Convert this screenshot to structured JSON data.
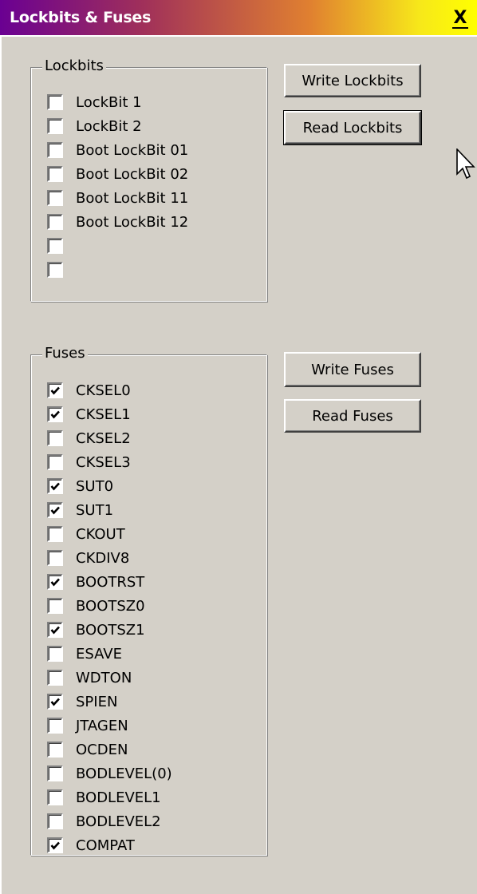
{
  "window": {
    "title": "Lockbits & Fuses",
    "close_label": "X"
  },
  "lockbits": {
    "legend": "Lockbits",
    "items": [
      {
        "label": "LockBit 1",
        "checked": false
      },
      {
        "label": "LockBit 2",
        "checked": false
      },
      {
        "label": "Boot LockBit 01",
        "checked": false
      },
      {
        "label": "Boot LockBit 02",
        "checked": false
      },
      {
        "label": "Boot LockBit 11",
        "checked": false
      },
      {
        "label": "Boot LockBit 12",
        "checked": false
      },
      {
        "label": "",
        "checked": false
      },
      {
        "label": "",
        "checked": false
      }
    ]
  },
  "lockbit_buttons": {
    "write_label": "Write Lockbits",
    "read_label": "Read Lockbits"
  },
  "fuses": {
    "legend": "Fuses",
    "items": [
      {
        "label": "CKSEL0",
        "checked": true
      },
      {
        "label": "CKSEL1",
        "checked": true
      },
      {
        "label": "CKSEL2",
        "checked": false
      },
      {
        "label": "CKSEL3",
        "checked": false
      },
      {
        "label": "SUT0",
        "checked": true
      },
      {
        "label": "SUT1",
        "checked": true
      },
      {
        "label": "CKOUT",
        "checked": false
      },
      {
        "label": "CKDIV8",
        "checked": false
      },
      {
        "label": "BOOTRST",
        "checked": true
      },
      {
        "label": "BOOTSZ0",
        "checked": false
      },
      {
        "label": "BOOTSZ1",
        "checked": true
      },
      {
        "label": "ESAVE",
        "checked": false
      },
      {
        "label": "WDTON",
        "checked": false
      },
      {
        "label": "SPIEN",
        "checked": true
      },
      {
        "label": "JTAGEN",
        "checked": false
      },
      {
        "label": "OCDEN",
        "checked": false
      },
      {
        "label": "BODLEVEL(0)",
        "checked": false
      },
      {
        "label": "BODLEVEL1",
        "checked": false
      },
      {
        "label": "BODLEVEL2",
        "checked": false
      },
      {
        "label": "COMPAT",
        "checked": true
      }
    ]
  },
  "fuse_buttons": {
    "write_label": "Write Fuses",
    "read_label": "Read Fuses"
  },
  "colors": {
    "face": "#d4d0c8",
    "title_start": "#6a0092",
    "title_end": "#ffff00"
  },
  "icons": {
    "close": "close-icon",
    "pointer": "mouse-pointer-icon",
    "check": "checkmark-icon"
  }
}
